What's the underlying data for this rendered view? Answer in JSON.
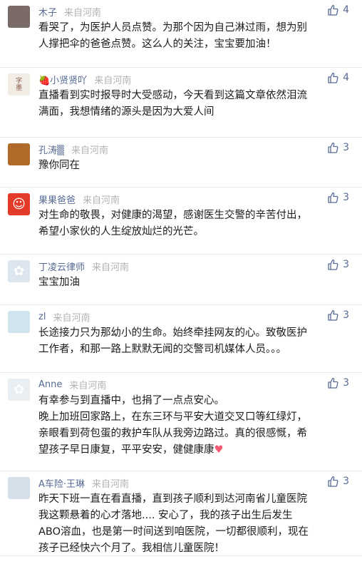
{
  "comments": [
    {
      "name": "木子",
      "location": "来自河南",
      "likes": "4",
      "lines": [
        "看哭了，为医护人员点赞。为那个因为自己淋过雨，想为别",
        "人撑把伞的爸爸点赞。这么人的关注，宝宝要加油！"
      ]
    },
    {
      "name": "🍓小贤贤吖",
      "location": "来自河南",
      "likes": "4",
      "lines": [
        "直播看到实时报导时大受感动，今天看到这篇文章依然泪流",
        "满面，我想情绪的源头是因为大爱人间"
      ]
    },
    {
      "name": "孔涛▒",
      "location": "来自河南",
      "likes": "3",
      "lines": [
        "豫你同在"
      ]
    },
    {
      "name": "果果爸爸",
      "location": "来自河南",
      "likes": "3",
      "lines": [
        "对生命的敬畏，对健康的渴望，感谢医生交警的辛苦付出，",
        "希望小家伙的人生绽放灿烂的光芒。"
      ]
    },
    {
      "name": "丁凌云律师",
      "location": "来自河南",
      "likes": "3",
      "lines": [
        "宝宝加油"
      ]
    },
    {
      "name": "zl",
      "location": "来自河南",
      "likes": "3",
      "lines": [
        "长途接力只为那幼小的生命。始终牵挂网友的心。致敬医护",
        "工作者，和那一路上默默无闻的交警司机媒体人员。。。"
      ]
    },
    {
      "name": "Anne",
      "location": "来自河南",
      "likes": "3",
      "lines": [
        "有幸参与到直播中，也捐了一点点安心。",
        "晚上加班回家路上，在东三环与平安大道交叉口等红绿灯，",
        "亲眼看到荷包蛋的救护车队从我旁边路过。真的很感慨，希",
        "望孩子早日康复，平平安安，健健康康"
      ],
      "heart": "♥"
    },
    {
      "name": "A车险·王琳",
      "location": "来自河南",
      "likes": "3",
      "lines": [
        "昨天下班一直在看直播，直到孩子顺利到达河南省儿童医院",
        "我这颗悬着的心才落地.... 安心了，我的孩子出生后发生",
        "ABO溶血，也是第一时间送到咱医院，一切都很顺利，现在",
        "孩子已经快六个月了。我相信儿童医院！"
      ]
    }
  ],
  "avatars": [
    {
      "icon": "girl-avatar-icon",
      "bg": "#7a6a68"
    },
    {
      "icon": "calligraphy-avatar-icon",
      "bg": "#f1ece4",
      "text": "字\n墨"
    },
    {
      "icon": "sunset-avatar-icon",
      "bg": "#b06a2a"
    },
    {
      "icon": "cartoon-avatar-icon",
      "bg": "#e33a2a",
      "text": "☺"
    },
    {
      "icon": "flower-avatar-icon",
      "bg": "#dde5ef",
      "text": "✿"
    },
    {
      "icon": "baby-avatar-icon",
      "bg": "#cfe4ec"
    },
    {
      "icon": "lotus-avatar-icon",
      "bg": "#e8eef2",
      "text": "✿"
    },
    {
      "icon": "woman-avatar-icon",
      "bg": "#d6e0ea"
    }
  ],
  "colors": {
    "name": "#576b95",
    "location": "#b2b2b2",
    "heart": "#f25a75"
  }
}
